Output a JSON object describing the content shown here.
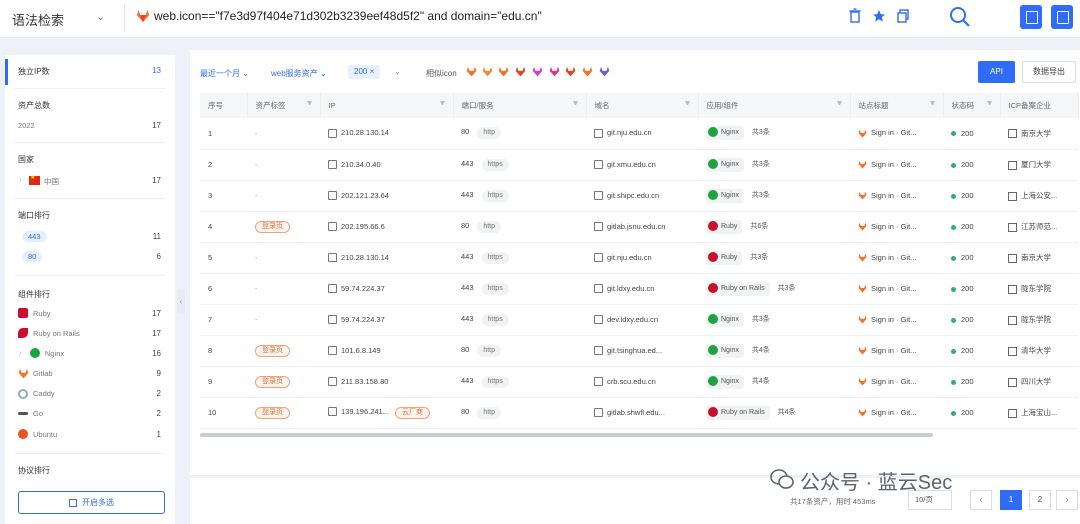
{
  "topbar": {
    "mode_label": "语法检索",
    "query": "web.icon==\"f7e3d97f404e71d302b3239eef48d5f2\" and domain=\"edu.cn\"",
    "icons": [
      "delete-icon",
      "star-icon",
      "copy-icon",
      "search-icon",
      "doc-icon",
      "save-icon"
    ]
  },
  "sidebar": {
    "independent_ip": {
      "label": "独立IP数",
      "count": "13"
    },
    "asset_total": {
      "label": "资产总数",
      "year": "2022",
      "count": "17"
    },
    "country": {
      "label": "国家",
      "item": "中国",
      "count": "17"
    },
    "ports": {
      "label": "端口排行",
      "items": [
        {
          "label": "443",
          "count": "11"
        },
        {
          "label": "80",
          "count": "6"
        }
      ]
    },
    "components": {
      "label": "组件排行",
      "items": [
        {
          "label": "Ruby",
          "count": "17"
        },
        {
          "label": "Ruby on Rails",
          "count": "17"
        },
        {
          "label": "Nginx",
          "count": "16"
        },
        {
          "label": "Gitlab",
          "count": "9"
        },
        {
          "label": "Caddy",
          "count": "2"
        },
        {
          "label": "Go",
          "count": "2"
        },
        {
          "label": "Ubuntu",
          "count": "1"
        }
      ]
    },
    "protocol": {
      "label": "协议排行"
    },
    "multi_select_button": "开启多选",
    "collapse_arrow": "‹"
  },
  "filters": {
    "time": "最近一个月",
    "asset_type": "web服务资产",
    "status_chip": "200 ×",
    "similar_icon": "相似icon",
    "api": "API",
    "export": "数据导出"
  },
  "table": {
    "headers": [
      "序号",
      "资产标签",
      "IP",
      "端口/服务",
      "域名",
      "应用/组件",
      "站点标题",
      "状态码",
      "ICP备案企业"
    ],
    "rows": [
      {
        "idx": "1",
        "tag": "-",
        "ip": "210.28.130.14",
        "port": "80",
        "svc": "http",
        "domain": "git.nju.edu.cn",
        "comp": "Nginx",
        "comp_type": "nginx",
        "more": "共3条",
        "title": "Sign in · Git...",
        "status": "200",
        "icp": "南京大学"
      },
      {
        "idx": "2",
        "tag": "-",
        "ip": "210.34.0.40",
        "port": "443",
        "svc": "https",
        "domain": "git.xmu.edu.cn",
        "comp": "Nginx",
        "comp_type": "nginx",
        "more": "共3条",
        "title": "Sign in · Git...",
        "status": "200",
        "icp": "厦门大学"
      },
      {
        "idx": "3",
        "tag": "-",
        "ip": "202.121.23.64",
        "port": "443",
        "svc": "https",
        "domain": "git.shipc.edu.cn",
        "comp": "Nginx",
        "comp_type": "nginx",
        "more": "共3条",
        "title": "Sign in · Git...",
        "status": "200",
        "icp": "上海公安..."
      },
      {
        "idx": "4",
        "tag": "登录页",
        "ip": "202.195.66.6",
        "port": "80",
        "svc": "http",
        "domain": "gitlab.jsnu.edu.cn",
        "comp": "Ruby",
        "comp_type": "ruby",
        "more": "共6条",
        "title": "Sign in · Git...",
        "status": "200",
        "icp": "江苏师范..."
      },
      {
        "idx": "5",
        "tag": "-",
        "ip": "210.28.130.14",
        "port": "443",
        "svc": "https",
        "domain": "git.nju.edu.cn",
        "comp": "Ruby",
        "comp_type": "ruby",
        "more": "共3条",
        "title": "Sign in · Git...",
        "status": "200",
        "icp": "南京大学"
      },
      {
        "idx": "6",
        "tag": "-",
        "ip": "59.74.224.37",
        "port": "443",
        "svc": "https",
        "domain": "git.ldxy.edu.cn",
        "comp": "Ruby on Rails",
        "comp_type": "rails",
        "more": "共3条",
        "title": "Sign in · Git...",
        "status": "200",
        "icp": "陇东学院"
      },
      {
        "idx": "7",
        "tag": "-",
        "ip": "59.74.224.37",
        "port": "443",
        "svc": "https",
        "domain": "dev.ldxy.edu.cn",
        "comp": "Nginx",
        "comp_type": "nginx",
        "more": "共3条",
        "title": "Sign in · Git...",
        "status": "200",
        "icp": "陇东学院"
      },
      {
        "idx": "8",
        "tag": "登录页",
        "ip": "101.6.8.149",
        "port": "80",
        "svc": "http",
        "domain": "git.tsinghua.ed...",
        "comp": "Nginx",
        "comp_type": "nginx",
        "more": "共4条",
        "title": "Sign in · Git...",
        "status": "200",
        "icp": "清华大学"
      },
      {
        "idx": "9",
        "tag": "登录页",
        "ip": "211.83.158.80",
        "port": "443",
        "svc": "https",
        "domain": "crb.scu.edu.cn",
        "comp": "Nginx",
        "comp_type": "nginx",
        "more": "共4条",
        "title": "Sign in · Git...",
        "status": "200",
        "icp": "四川大学"
      },
      {
        "idx": "10",
        "tag": "登录页",
        "ip": "139.196.241...",
        "ip_badge": "云厂商",
        "port": "80",
        "svc": "http",
        "domain": "gitlab.shwfl.edu...",
        "comp": "Ruby on Rails",
        "comp_type": "rails",
        "more": "共4条",
        "title": "Sign in · Git...",
        "status": "200",
        "icp": "上海宝山..."
      }
    ]
  },
  "footer": {
    "summary": "共17条资产，用时 453ms",
    "page_size": "10/页",
    "pages": [
      "1",
      "2"
    ],
    "prev": "‹",
    "next": "›"
  },
  "watermark": "公众号 · 蓝云Sec",
  "colors": {
    "accent": "#2f6df6",
    "ok_green": "#2bb36b",
    "login_orange": "#e86b36",
    "gitlab_orange": "#fc6d26"
  }
}
